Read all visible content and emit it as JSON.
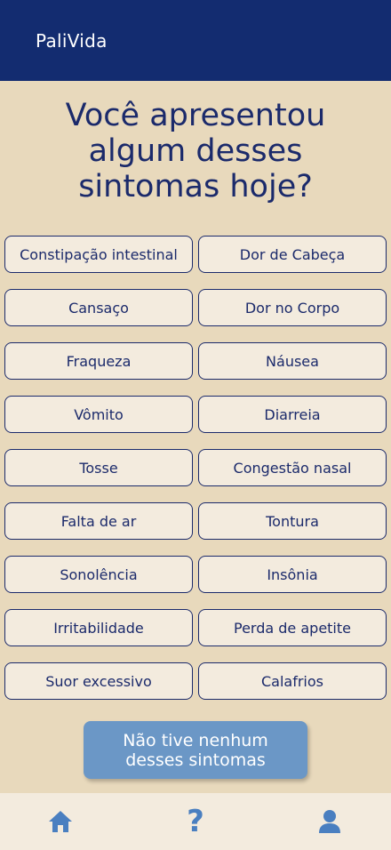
{
  "app": {
    "title": "PaliVida"
  },
  "question": "Você apresentou algum desses sintomas hoje?",
  "symptoms": [
    "Constipação intestinal",
    "Dor de Cabeça",
    "Cansaço",
    "Dor no Corpo",
    "Fraqueza",
    "Náusea",
    "Vômito",
    "Diarreia",
    "Tosse",
    "Congestão nasal",
    "Falta de ar",
    "Tontura",
    "Sonolência",
    "Insônia",
    "Irritabilidade",
    "Perda de apetite",
    "Suor excessivo",
    "Calafrios"
  ],
  "none_button": "Não tive nenhum desses sintomas",
  "nav": {
    "home_icon": "home-icon",
    "help_glyph": "?",
    "profile_icon": "user-icon"
  },
  "colors": {
    "header": "#132c70",
    "background": "#e8d9bc",
    "button_fill": "#f3ebde",
    "text": "#1b2a6b",
    "primary_button": "#6b97c6",
    "nav_icon": "#4a7fc0"
  }
}
